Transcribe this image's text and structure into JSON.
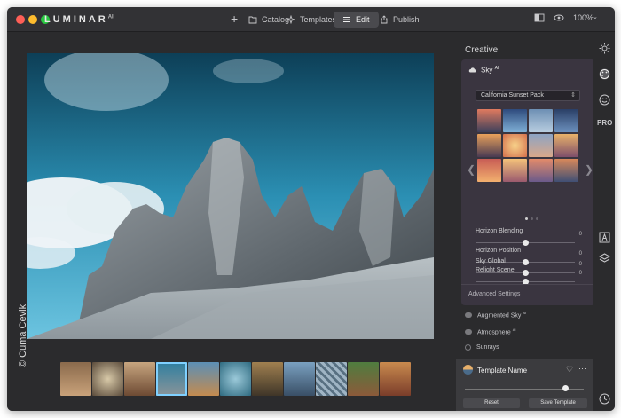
{
  "brand": {
    "name": "LUMINAR",
    "suffix": "AI"
  },
  "nav": {
    "catalog": "Catalog",
    "templates": "Templates",
    "edit": "Edit",
    "publish": "Publish"
  },
  "toolbar": {
    "zoom": "100%"
  },
  "photo": {
    "credit": "© Cuma Cevik"
  },
  "sidebar": {
    "panel_title": "Creative",
    "sky": {
      "title": "Sky",
      "badge": "AI",
      "pack": "California Sunset Pack",
      "sliders": [
        {
          "label": "Horizon Blending",
          "value": "0",
          "fill": 0.5
        },
        {
          "label": "Horizon Position",
          "value": "0",
          "fill": 0.5
        },
        {
          "label": "Relight Scene",
          "value": "0",
          "fill": 0.5
        },
        {
          "label": "Sky Global",
          "value": "0",
          "fill": 0.5
        }
      ],
      "advanced": "Advanced Settings"
    },
    "tools": [
      {
        "label": "Augmented Sky",
        "badge": "AI"
      },
      {
        "label": "Atmosphere",
        "badge": "AI"
      },
      {
        "label": "Sunrays",
        "badge": ""
      }
    ],
    "template": {
      "title": "Template Name",
      "reset": "Reset",
      "save": "Save Template",
      "slider_fill": 0.85
    }
  },
  "rail": {
    "pro_label": "PRO"
  },
  "colors": {
    "accent": "#7fd0ff",
    "panel": "#3a3540",
    "bg": "#2b2b2d"
  }
}
